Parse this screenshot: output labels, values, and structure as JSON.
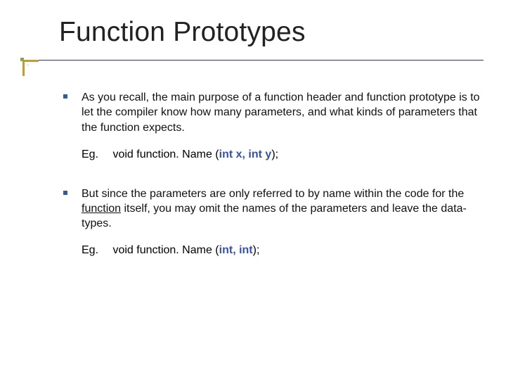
{
  "title": "Function Prototypes",
  "bullets": [
    {
      "text": "As you recall, the main purpose of a function header and function prototype is to let the compiler know how many parameters, and what kinds of parameters that the function expects.",
      "example": {
        "label": "Eg.",
        "prefix": "void  function. Name (",
        "kw": "int x, int y",
        "suffix": ");"
      }
    },
    {
      "text_pre": "But since the parameters are only referred to by name within the code for the ",
      "text_underlined": "function",
      "text_post": " itself, you may omit the names of the parameters and leave the data-types.",
      "example": {
        "label": "Eg.",
        "prefix": "void  function. Name (",
        "kw": "int, int",
        "suffix": ");"
      }
    }
  ]
}
